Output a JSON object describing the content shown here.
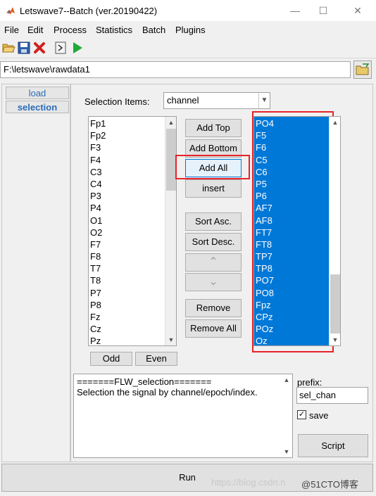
{
  "window": {
    "title": "Letswave7--Batch (ver.20190422)",
    "minimize": "—",
    "maximize": "☐",
    "close": "✕"
  },
  "menu": [
    "File",
    "Edit",
    "Process",
    "Statistics",
    "Batch",
    "Plugins"
  ],
  "toolbar": {
    "icons": [
      "open-folder-icon",
      "save-disk-icon",
      "delete-x-icon",
      "script-icon",
      "run-play-icon"
    ]
  },
  "path": {
    "value": "F:\\letswave\\rawdata1"
  },
  "side_tabs": {
    "load": "load",
    "selection": "selection"
  },
  "selection": {
    "items_label": "Selection Items:",
    "items_value": "channel",
    "available": [
      "Fp1",
      "Fp2",
      "F3",
      "F4",
      "C3",
      "C4",
      "P3",
      "P4",
      "O1",
      "O2",
      "F7",
      "F8",
      "T7",
      "T8",
      "P7",
      "P8",
      "Fz",
      "Cz",
      "Pz"
    ],
    "selected": [
      "PO4",
      "F5",
      "F6",
      "C5",
      "C6",
      "P5",
      "P6",
      "AF7",
      "AF8",
      "FT7",
      "FT8",
      "TP7",
      "TP8",
      "PO7",
      "PO8",
      "Fpz",
      "CPz",
      "POz",
      "Oz"
    ]
  },
  "buttons": {
    "add_top": "Add Top",
    "add_bottom": "Add Bottom",
    "add_all": "Add All",
    "insert": "insert",
    "sort_asc": "Sort Asc.",
    "sort_desc": "Sort Desc.",
    "move_up": "⌃",
    "move_down": "⌄",
    "remove": "Remove",
    "remove_all": "Remove All",
    "odd": "Odd",
    "even": "Even",
    "script": "Script",
    "run": "Run"
  },
  "info": {
    "line1": "=======FLW_selection=======",
    "line2": "Selection the signal by channel/epoch/index."
  },
  "prefix": {
    "label": "prefix:",
    "value": "sel_chan"
  },
  "save": {
    "label": "save",
    "checked": true
  },
  "watermark": {
    "url": "https://blog.csdn.n",
    "brand": "@51CTO博客"
  }
}
